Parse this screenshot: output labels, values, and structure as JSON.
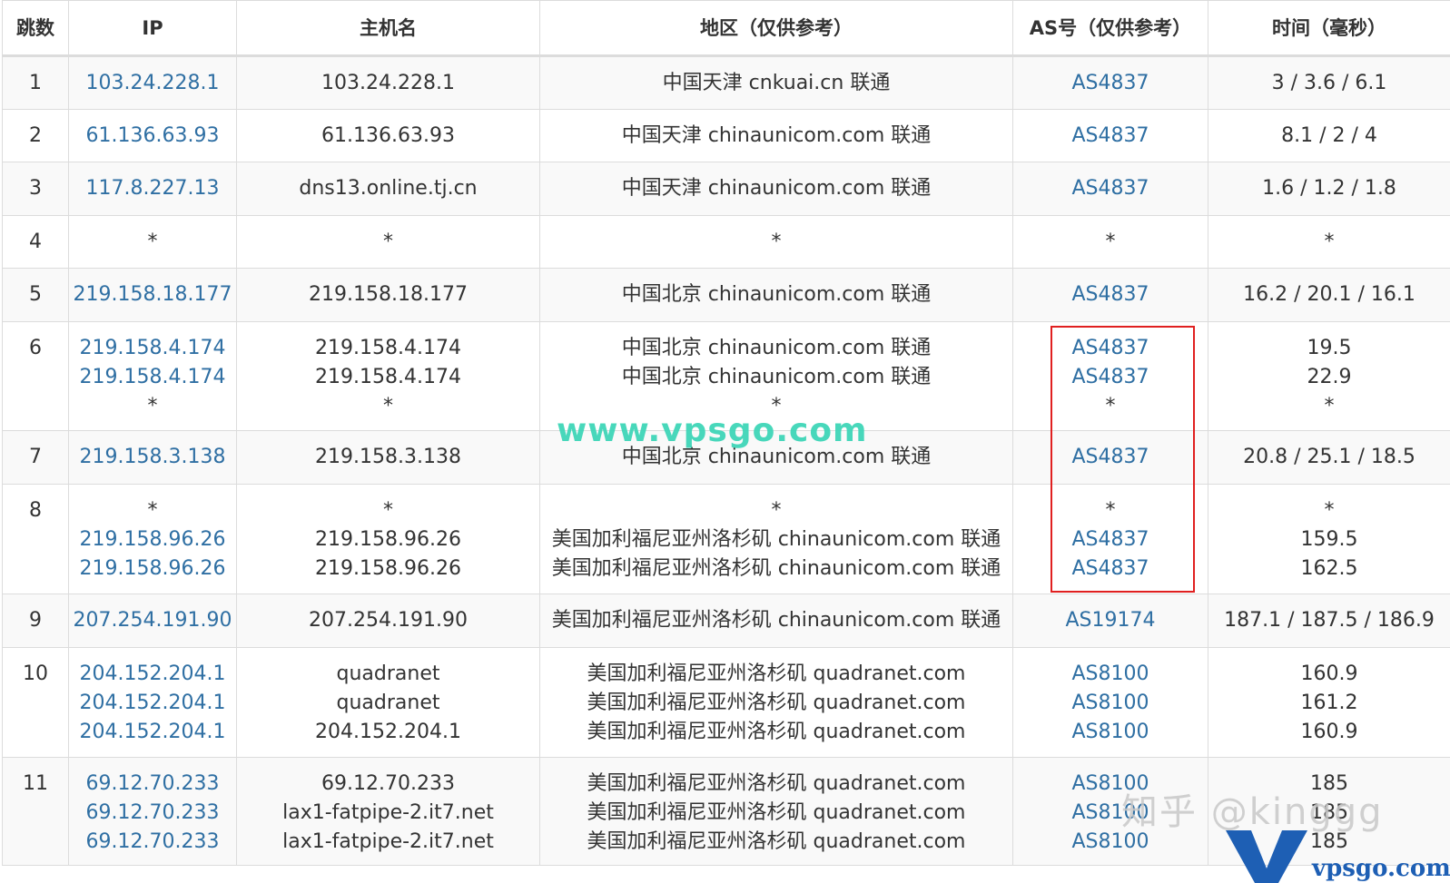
{
  "headers": [
    "跳数",
    "IP",
    "主机名",
    "地区（仅供参考）",
    "AS号（仅供参考）",
    "时间（毫秒）"
  ],
  "rows": [
    {
      "hop": "1",
      "ips": [
        "103.24.228.1"
      ],
      "hosts": [
        "103.24.228.1"
      ],
      "regions": [
        "中国天津 cnkuai.cn 联通"
      ],
      "as": [
        "AS4837"
      ],
      "times": [
        "3 / 3.6 / 6.1"
      ]
    },
    {
      "hop": "2",
      "ips": [
        "61.136.63.93"
      ],
      "hosts": [
        "61.136.63.93"
      ],
      "regions": [
        "中国天津 chinaunicom.com 联通"
      ],
      "as": [
        "AS4837"
      ],
      "times": [
        "8.1 / 2 / 4"
      ]
    },
    {
      "hop": "3",
      "ips": [
        "117.8.227.13"
      ],
      "hosts": [
        "dns13.online.tj.cn"
      ],
      "regions": [
        "中国天津 chinaunicom.com 联通"
      ],
      "as": [
        "AS4837"
      ],
      "times": [
        "1.6 / 1.2 / 1.8"
      ]
    },
    {
      "hop": "4",
      "ips": [
        "*"
      ],
      "hosts": [
        "*"
      ],
      "regions": [
        "*"
      ],
      "as": [
        "*"
      ],
      "times": [
        "*"
      ]
    },
    {
      "hop": "5",
      "ips": [
        "219.158.18.177"
      ],
      "hosts": [
        "219.158.18.177"
      ],
      "regions": [
        "中国北京 chinaunicom.com 联通"
      ],
      "as": [
        "AS4837"
      ],
      "times": [
        "16.2 / 20.1 / 16.1"
      ]
    },
    {
      "hop": "6",
      "ips": [
        "219.158.4.174",
        "219.158.4.174",
        "*"
      ],
      "hosts": [
        "219.158.4.174",
        "219.158.4.174",
        "*"
      ],
      "regions": [
        "中国北京 chinaunicom.com 联通",
        "中国北京 chinaunicom.com 联通",
        "*"
      ],
      "as": [
        "AS4837",
        "AS4837",
        "*"
      ],
      "times": [
        "19.5",
        "22.9",
        "*"
      ]
    },
    {
      "hop": "7",
      "ips": [
        "219.158.3.138"
      ],
      "hosts": [
        "219.158.3.138"
      ],
      "regions": [
        "中国北京 chinaunicom.com 联通"
      ],
      "as": [
        "AS4837"
      ],
      "times": [
        "20.8 / 25.1 / 18.5"
      ]
    },
    {
      "hop": "8",
      "ips": [
        "*",
        "219.158.96.26",
        "219.158.96.26"
      ],
      "hosts": [
        "*",
        "219.158.96.26",
        "219.158.96.26"
      ],
      "regions": [
        "*",
        "美国加利福尼亚州洛杉矶 chinaunicom.com 联通",
        "美国加利福尼亚州洛杉矶 chinaunicom.com 联通"
      ],
      "as": [
        "*",
        "AS4837",
        "AS4837"
      ],
      "times": [
        "*",
        "159.5",
        "162.5"
      ]
    },
    {
      "hop": "9",
      "ips": [
        "207.254.191.90"
      ],
      "hosts": [
        "207.254.191.90"
      ],
      "regions": [
        "美国加利福尼亚州洛杉矶 chinaunicom.com 联通"
      ],
      "as": [
        "AS19174"
      ],
      "times": [
        "187.1 / 187.5 / 186.9"
      ]
    },
    {
      "hop": "10",
      "ips": [
        "204.152.204.1",
        "204.152.204.1",
        "204.152.204.1"
      ],
      "hosts": [
        "quadranet",
        "quadranet",
        "204.152.204.1"
      ],
      "regions": [
        "美国加利福尼亚州洛杉矶 quadranet.com",
        "美国加利福尼亚州洛杉矶 quadranet.com",
        "美国加利福尼亚州洛杉矶 quadranet.com"
      ],
      "as": [
        "AS8100",
        "AS8100",
        "AS8100"
      ],
      "times": [
        "160.9",
        "161.2",
        "160.9"
      ]
    },
    {
      "hop": "11",
      "ips": [
        "69.12.70.233",
        "69.12.70.233",
        "69.12.70.233"
      ],
      "hosts": [
        "69.12.70.233",
        "lax1-fatpipe-2.it7.net",
        "lax1-fatpipe-2.it7.net"
      ],
      "regions": [
        "美国加利福尼亚州洛杉矶 quadranet.com",
        "美国加利福尼亚州洛杉矶 quadranet.com",
        "美国加利福尼亚州洛杉矶 quadranet.com"
      ],
      "as": [
        "AS8100",
        "AS8100",
        "AS8100"
      ],
      "times": [
        "185",
        "185",
        "185"
      ]
    }
  ],
  "watermarks": {
    "vpsgo_text": "www.vpsgo.com",
    "zhihu_text": "知乎 @kinggg",
    "logo_text": "vpsgo.com"
  },
  "colors": {
    "link": "#2f6fa3",
    "highlight_border": "#e02020",
    "watermark_green": "#3fd6b8",
    "logo_blue": "#1e5fb4"
  }
}
